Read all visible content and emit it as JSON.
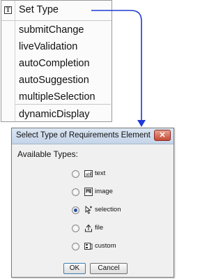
{
  "menu": {
    "title": "Set Type",
    "items": [
      "submitChange",
      "liveValidation",
      "autoCompletion",
      "autoSuggestion",
      "multipleSelection"
    ],
    "footer_item": "dynamicDisplay"
  },
  "dialog": {
    "title": "Select Type of Requirements Element",
    "close_glyph": "✕",
    "available_label": "Available Types:",
    "options": [
      {
        "label": "text",
        "icon": "text-field-icon",
        "selected": false
      },
      {
        "label": "image",
        "icon": "image-icon",
        "selected": false
      },
      {
        "label": "selection",
        "icon": "pointer-icon",
        "selected": true
      },
      {
        "label": "file",
        "icon": "upload-icon",
        "selected": false
      },
      {
        "label": "custom",
        "icon": "custom-icon",
        "selected": false
      }
    ],
    "ok_label": "OK",
    "cancel_label": "Cancel"
  },
  "colors": {
    "arrow": "#1f3ad6",
    "close_button": "#c74a36",
    "radio_selected": "#2a4d9c"
  }
}
